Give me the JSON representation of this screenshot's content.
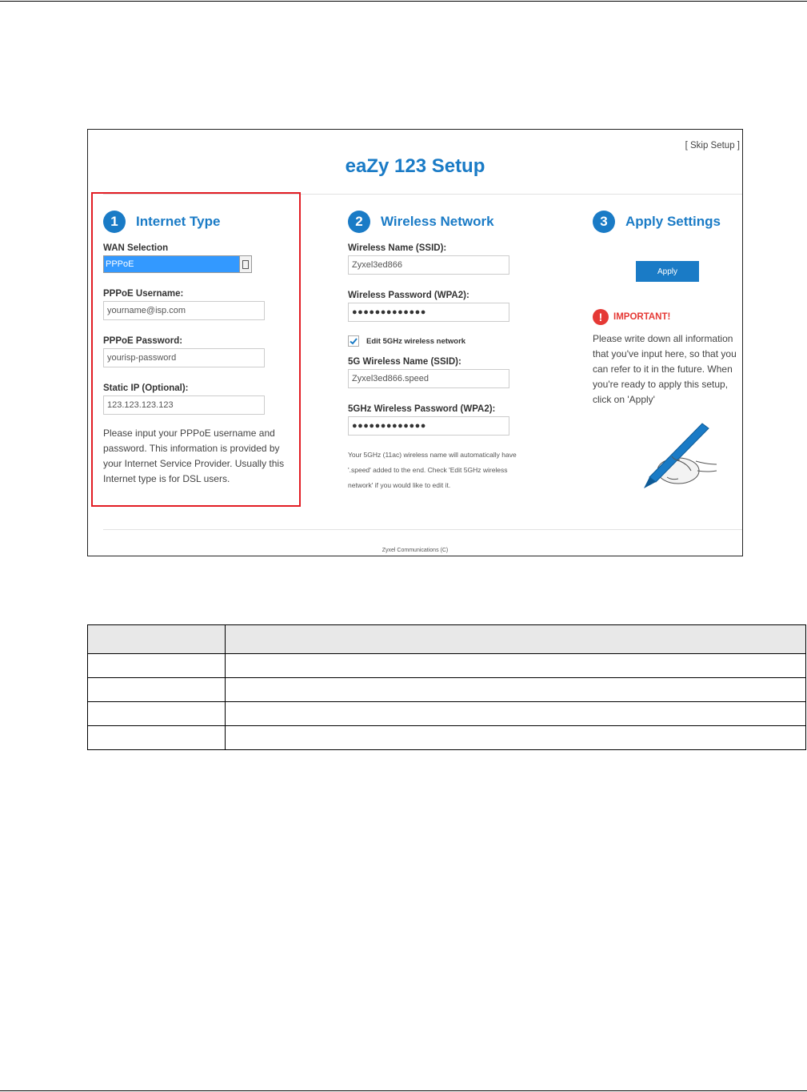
{
  "app": {
    "title": "eaZy 123 Setup",
    "skip_link": "[ Skip Setup ]",
    "footer": "Zyxel Communications (C)",
    "accent_color": "#1a7bc6",
    "highlight_color": "#e21d24"
  },
  "step1": {
    "number": "1",
    "title": "Internet Type",
    "wan_label": "WAN Selection",
    "wan_value": "PPPoE",
    "username_label": "PPPoE Username:",
    "username_value": "yourname@isp.com",
    "password_label": "PPPoE Password:",
    "password_value": "yourisp-password",
    "static_ip_label": "Static IP (Optional):",
    "static_ip_value": "123.123.123.123",
    "description": "Please input your PPPoE username and password. This information is provided by your Internet Service Provider. Usually this Internet type is for DSL users."
  },
  "step2": {
    "number": "2",
    "title": "Wireless Network",
    "ssid_label": "Wireless Name (SSID):",
    "ssid_value": "Zyxel3ed866",
    "password_label": "Wireless Password (WPA2):",
    "password_value": "●●●●●●●●●●●●●",
    "edit5g_label": "Edit 5GHz wireless network",
    "edit5g_checked": true,
    "ssid5g_label": "5G Wireless Name (SSID):",
    "ssid5g_value": "Zyxel3ed866.speed",
    "password5g_label": "5GHz Wireless Password (WPA2):",
    "password5g_value": "●●●●●●●●●●●●●",
    "note": "Your 5GHz (11ac) wireless name will automatically have '.speed' added to the end. Check 'Edit 5GHz wireless network' if you would like to edit it."
  },
  "step3": {
    "number": "3",
    "title": "Apply Settings",
    "apply_label": "Apply",
    "important_title": "IMPORTANT!",
    "important_text": "Please write down all information that you've input here, so that you can refer to it in the future. When you're ready to apply this setup, click on 'Apply'"
  },
  "table": {
    "headers": [
      "",
      ""
    ],
    "rows": [
      [
        "",
        ""
      ],
      [
        "",
        ""
      ],
      [
        "",
        ""
      ],
      [
        "",
        ""
      ]
    ]
  }
}
